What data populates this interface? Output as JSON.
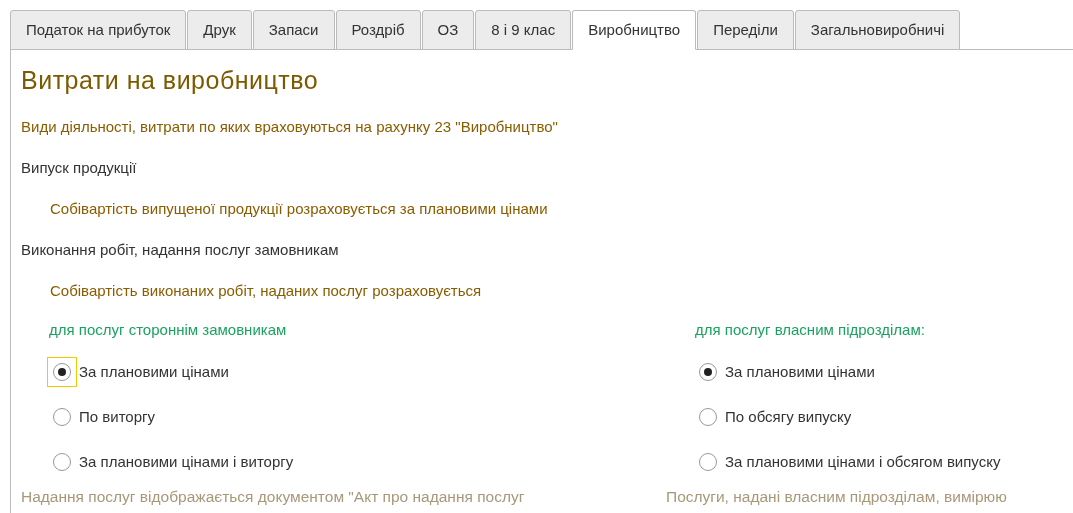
{
  "tabs": [
    {
      "label": "Податок на прибуток",
      "selected": false
    },
    {
      "label": "Друк",
      "selected": false
    },
    {
      "label": "Запаси",
      "selected": false
    },
    {
      "label": "Роздріб",
      "selected": false
    },
    {
      "label": "ОЗ",
      "selected": false
    },
    {
      "label": "8 і 9 клас",
      "selected": false
    },
    {
      "label": "Виробництво",
      "selected": true
    },
    {
      "label": "Переділи",
      "selected": false
    },
    {
      "label": "Загальновиробничі",
      "selected": false
    }
  ],
  "title": "Витрати на виробництво",
  "lines": [
    {
      "kind": "hint",
      "text": "Види діяльності, витрати по яких враховуються на рахунку 23 \"Виробництво\""
    },
    {
      "kind": "section",
      "text": "Випуск продукції"
    },
    {
      "kind": "indented",
      "text": "Собівартість випущеної продукції розраховується за плановими цінами"
    },
    {
      "kind": "section",
      "text": "Виконання робіт, надання послуг замовникам"
    },
    {
      "kind": "indented",
      "text": "Собівартість виконаних робіт, наданих послуг розраховується"
    }
  ],
  "groups": [
    {
      "heading": "для послуг стороннім замовникам",
      "options": [
        {
          "label": "За плановими цінами",
          "selected": true,
          "focused": true
        },
        {
          "label": "По виторгу",
          "selected": false,
          "focused": false
        },
        {
          "label": "За плановими цінами і виторгу",
          "selected": false,
          "focused": false
        }
      ],
      "note": "Надання послуг відображається документом \"Акт про надання послуг"
    },
    {
      "heading": "для послуг власним підрозділам:",
      "options": [
        {
          "label": "За плановими цінами",
          "selected": true,
          "focused": false
        },
        {
          "label": "По обсягу випуску",
          "selected": false,
          "focused": false
        },
        {
          "label": "За плановими цінами і обсягом випуску",
          "selected": false,
          "focused": false
        }
      ],
      "note": "Послуги, надані власним підрозділам, вимірюю"
    }
  ]
}
